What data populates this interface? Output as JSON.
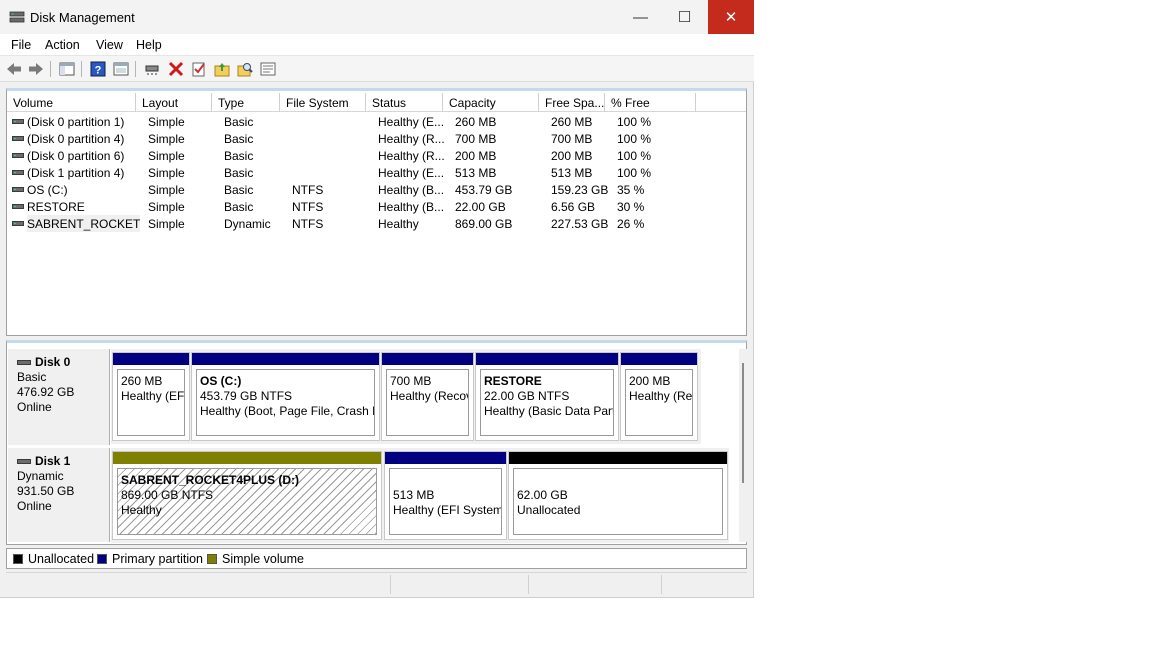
{
  "window": {
    "title": "Disk Management",
    "buttons": {
      "minimize": "—",
      "maximize": "☐",
      "close": "✕"
    }
  },
  "menu": [
    "File",
    "Action",
    "View",
    "Help"
  ],
  "toolbar": {
    "icons": [
      "back-icon",
      "forward-icon",
      "show-hide-console-tree-icon",
      "help-icon",
      "properties-icon",
      "connect-icon",
      "delete-icon",
      "checklist-icon",
      "folder-up-icon",
      "search-folder-icon",
      "settings-list-icon"
    ]
  },
  "volumes": {
    "columns": [
      "Volume",
      "Layout",
      "Type",
      "File System",
      "Status",
      "Capacity",
      "Free Spa...",
      "% Free"
    ],
    "rows": [
      [
        "(Disk 0 partition 1)",
        "Simple",
        "Basic",
        "",
        "Healthy (E...",
        "260 MB",
        "260 MB",
        "100 %"
      ],
      [
        "(Disk 0 partition 4)",
        "Simple",
        "Basic",
        "",
        "Healthy (R...",
        "700 MB",
        "700 MB",
        "100 %"
      ],
      [
        "(Disk 0 partition 6)",
        "Simple",
        "Basic",
        "",
        "Healthy (R...",
        "200 MB",
        "200 MB",
        "100 %"
      ],
      [
        "(Disk 1 partition 4)",
        "Simple",
        "Basic",
        "",
        "Healthy (E...",
        "513 MB",
        "513 MB",
        "100 %"
      ],
      [
        "OS (C:)",
        "Simple",
        "Basic",
        "NTFS",
        "Healthy (B...",
        "453.79 GB",
        "159.23 GB",
        "35 %"
      ],
      [
        "RESTORE",
        "Simple",
        "Basic",
        "NTFS",
        "Healthy (B...",
        "22.00 GB",
        "6.56 GB",
        "30 %"
      ],
      [
        "SABRENT_ROCKET...",
        "Simple",
        "Dynamic",
        "NTFS",
        "Healthy",
        "869.00 GB",
        "227.53 GB",
        "26 %"
      ]
    ]
  },
  "disks": [
    {
      "name": "Disk 0",
      "type": "Basic",
      "size": "476.92 GB",
      "state": "Online",
      "partitions": [
        {
          "title": "",
          "line1": "260 MB",
          "line2": "Healthy (EFI"
        },
        {
          "title": "OS  (C:)",
          "line1": "453.79 GB NTFS",
          "line2": "Healthy (Boot, Page File, Crash D"
        },
        {
          "title": "",
          "line1": "700 MB",
          "line2": "Healthy (Recov"
        },
        {
          "title": "RESTORE",
          "line1": "22.00 GB NTFS",
          "line2": "Healthy (Basic Data Parti"
        },
        {
          "title": "",
          "line1": "200 MB",
          "line2": "Healthy (Rec"
        }
      ]
    },
    {
      "name": "Disk 1",
      "type": "Dynamic",
      "size": "931.50 GB",
      "state": "Online",
      "partitions": [
        {
          "title": "SABRENT_ROCKET4PLUS  (D:)",
          "line1": "869.00 GB NTFS",
          "line2": "Healthy"
        },
        {
          "title": "",
          "line1": "513 MB",
          "line2": "Healthy (EFI System"
        },
        {
          "title": "",
          "line1": "62.00 GB",
          "line2": "Unallocated"
        }
      ]
    }
  ],
  "legend": [
    {
      "label": "Unallocated",
      "color": "#000000"
    },
    {
      "label": "Primary partition",
      "color": "#000080"
    },
    {
      "label": "Simple volume",
      "color": "#808000"
    }
  ],
  "colors": {
    "primary": "#000080",
    "simple": "#808000",
    "unallocated": "#000000",
    "close": "#c42b1c"
  }
}
